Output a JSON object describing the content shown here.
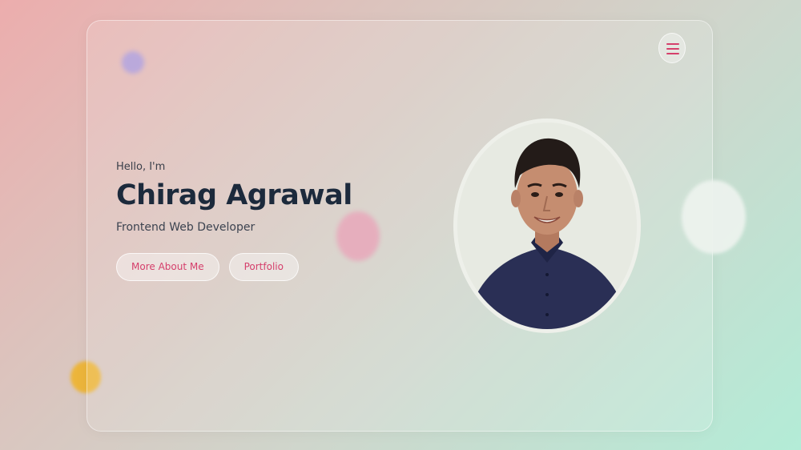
{
  "hero": {
    "greeting": "Hello, I'm",
    "name": "Chirag Agrawal",
    "role": "Frontend Web Developer",
    "buttons": {
      "more_about": "More About Me",
      "portfolio": "Portfolio"
    }
  },
  "nav": {
    "menu_icon": "hamburger-icon"
  },
  "colors": {
    "accent": "#d53f6b",
    "heading": "#1c2a3c",
    "text": "#3c4350"
  }
}
